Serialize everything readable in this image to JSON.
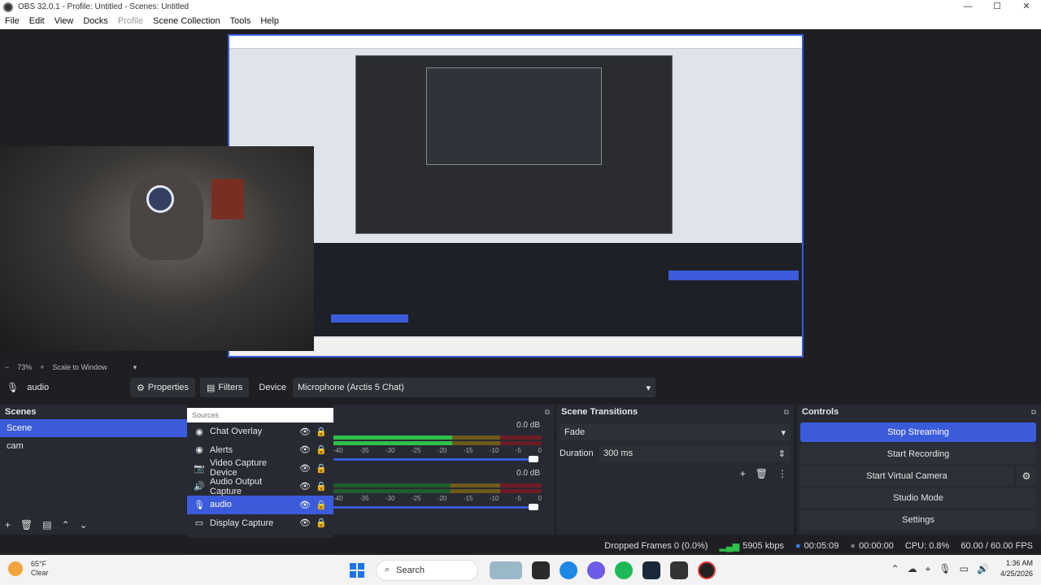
{
  "window": {
    "title": "OBS 32.0.1 - Profile: Untitled - Scenes: Untitled",
    "minimize": "—",
    "maximize": "☐",
    "close": "✕"
  },
  "menu": [
    "File",
    "Edit",
    "View",
    "Docks",
    "Profile",
    "Scene Collection",
    "Tools",
    "Help"
  ],
  "preview": {
    "zoom_minus": "−",
    "zoom": "73%",
    "zoom_plus": "+",
    "scale_mode": "Scale to Window",
    "scale_arrow": "▾"
  },
  "context": {
    "source_name": "audio",
    "properties": "Properties",
    "filters": "Filters",
    "device_label": "Device",
    "device_value": "Microphone (Arctis 5 Chat)",
    "dropdown_arrow": "▾"
  },
  "scenes": {
    "title": "Scenes",
    "items": [
      "Scene",
      "cam"
    ],
    "selected": "Scene",
    "toolbar": [
      "+",
      "🗑",
      "▤",
      "⌃",
      "⌄"
    ]
  },
  "sources": {
    "title": "Sources",
    "items": [
      {
        "label": "Chat Overlay",
        "icon": "globe-icon"
      },
      {
        "label": "Alerts",
        "icon": "globe-icon"
      },
      {
        "label": "Video Capture Device",
        "icon": "camera-icon"
      },
      {
        "label": "Audio Output Capture",
        "icon": "speaker-icon"
      },
      {
        "label": "audio",
        "icon": "microphone-icon"
      },
      {
        "label": "Display Capture",
        "icon": "monitor-icon"
      }
    ],
    "selected": "audio",
    "toolbar": [
      "+",
      "🗑",
      "⚙",
      "⌃",
      "⌄"
    ]
  },
  "mixer": {
    "channels": [
      {
        "db": "0.0 dB",
        "level": 0.57
      },
      {
        "db": "0.0 dB",
        "level": 0.0
      }
    ],
    "scale": [
      "-40",
      "-35",
      "-30",
      "-25",
      "-20",
      "-15",
      "-10",
      "-5",
      "0"
    ],
    "volume": 1.0
  },
  "transitions": {
    "title": "Scene Transitions",
    "selected": "Fade",
    "duration_label": "Duration",
    "duration_value": "300 ms",
    "toolbar": [
      "+",
      "🗑",
      "⋮"
    ]
  },
  "controls": {
    "title": "Controls",
    "stop_streaming": "Stop Streaming",
    "start_recording": "Start Recording",
    "start_virtual_camera": "Start Virtual Camera",
    "studio_mode": "Studio Mode",
    "settings": "Settings",
    "gear": "⚙"
  },
  "status": {
    "dropped_frames": "Dropped Frames 0 (0.0%)",
    "bitrate": "5905 kbps",
    "stream_time": "00:05:09",
    "rec_time": "00:00:00",
    "cpu": "CPU: 0.8%",
    "fps": "60.00 / 60.00 FPS"
  },
  "taskbar": {
    "temperature": "65°F",
    "condition": "Clear",
    "search": "Search",
    "time": "1:36 AM",
    "date": "4/25/2026"
  },
  "colors": {
    "accent": "#3b5bdb",
    "meter_green": "#30c04a",
    "panel": "#272a33",
    "background": "#1f1f23"
  }
}
